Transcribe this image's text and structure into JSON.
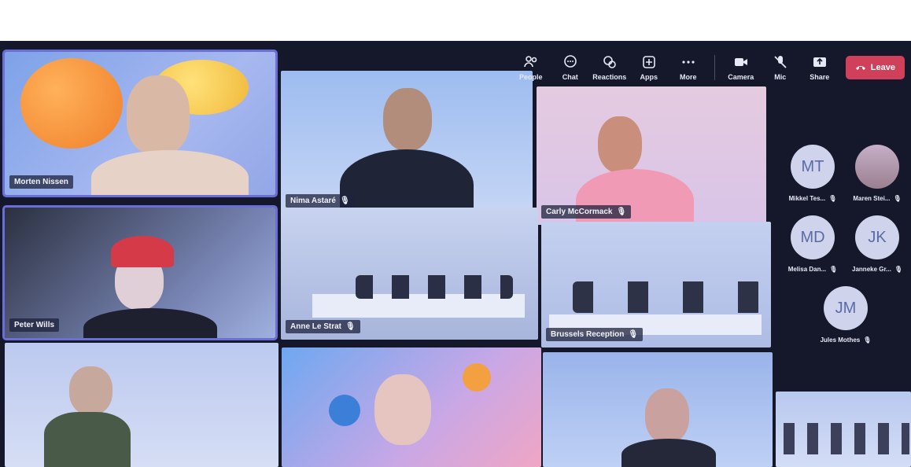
{
  "toolbar": {
    "buttons": [
      {
        "label": "People",
        "icon": "people-icon"
      },
      {
        "label": "Chat",
        "icon": "chat-icon"
      },
      {
        "label": "Reactions",
        "icon": "reactions-icon"
      },
      {
        "label": "Apps",
        "icon": "apps-icon"
      },
      {
        "label": "More",
        "icon": "more-icon"
      },
      {
        "label": "Camera",
        "icon": "camera-icon"
      },
      {
        "label": "Mic",
        "icon": "mic-off-icon"
      },
      {
        "label": "Share",
        "icon": "share-icon"
      }
    ],
    "leave_label": "Leave"
  },
  "tiles": {
    "t1": {
      "name": "Morten Nissen"
    },
    "t2": {
      "name": "Nima Astaré"
    },
    "t3": {
      "name": "Carly McCormack"
    },
    "t4": {
      "name": "Peter Wills"
    },
    "t5": {
      "name": "Anne Le Strat"
    },
    "t6": {
      "name": "Brussels Reception"
    }
  },
  "participants": [
    {
      "initials": "MT",
      "name": "Mikkel Tes..."
    },
    {
      "initials": "",
      "name": "Maren Stei..."
    },
    {
      "initials": "MD",
      "name": "Melisa Dan..."
    },
    {
      "initials": "JK",
      "name": "Janneke Gr..."
    },
    {
      "initials": "JM",
      "name": "Jules Mothes"
    }
  ],
  "colors": {
    "leave": "#d0405a",
    "active_border": "#6a6fd8",
    "avatar_bg": "#cfd4ec"
  }
}
